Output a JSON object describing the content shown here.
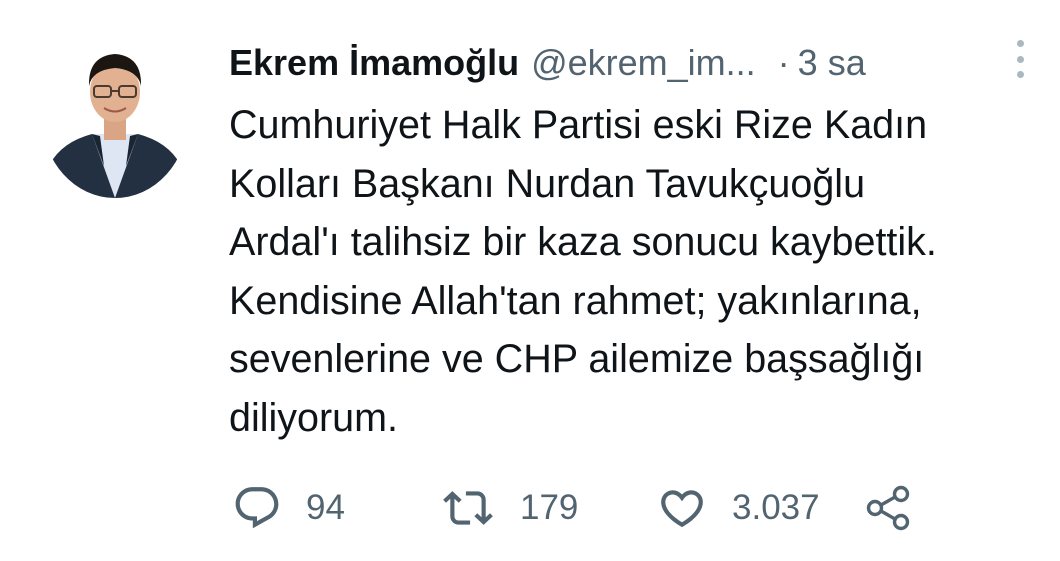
{
  "author": {
    "display_name": "Ekrem İmamoğlu",
    "handle": "@ekrem_im...",
    "separator": "·",
    "time": "3 sa"
  },
  "tweet": {
    "lines": [
      "Cumhuriyet Halk Partisi eski Rize Kadın",
      "Kolları Başkanı Nurdan Tavukçuoğlu",
      "Ardal'ı talihsiz bir kaza sonucu kaybettik.",
      "Kendisine Allah'tan rahmet; yakınlarına,",
      "sevenlerine ve CHP ailemize başsağlığı",
      "diliyorum."
    ]
  },
  "actions": {
    "reply": {
      "icon": "reply-icon",
      "count": "94"
    },
    "retweet": {
      "icon": "retweet-icon",
      "count": "179"
    },
    "like": {
      "icon": "heart-icon",
      "count": "3.037"
    },
    "share": {
      "icon": "share-icon"
    }
  },
  "colors": {
    "text_primary": "#0f1419",
    "text_secondary": "#536471",
    "icon": "#536471",
    "more_dots": "#aab8c2"
  }
}
